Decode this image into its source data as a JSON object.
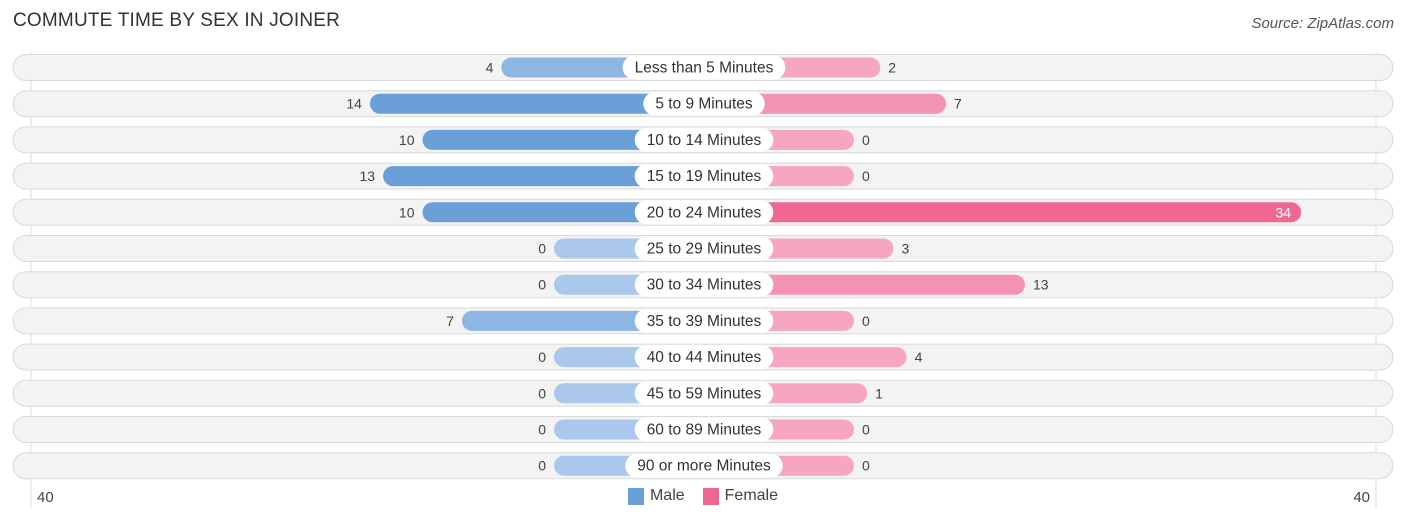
{
  "title": "COMMUTE TIME BY SEX IN JOINER",
  "source": "Source: ZipAtlas.com",
  "colors": {
    "male_strong": "#6a9fd8",
    "male_light": "#a9c8ec",
    "female_strong": "#f06792",
    "female_light": "#f7a6c0",
    "row_bg": "#f3f3f3"
  },
  "chart_data": {
    "type": "bar",
    "orientation": "horizontal-diverging",
    "title": "COMMUTE TIME BY SEX IN JOINER",
    "categories": [
      "Less than 5 Minutes",
      "5 to 9 Minutes",
      "10 to 14 Minutes",
      "15 to 19 Minutes",
      "20 to 24 Minutes",
      "25 to 29 Minutes",
      "30 to 34 Minutes",
      "35 to 39 Minutes",
      "40 to 44 Minutes",
      "45 to 59 Minutes",
      "60 to 89 Minutes",
      "90 or more Minutes"
    ],
    "series": [
      {
        "name": "Male",
        "side": "left",
        "values": [
          4,
          14,
          10,
          13,
          10,
          0,
          0,
          7,
          0,
          0,
          0,
          0
        ]
      },
      {
        "name": "Female",
        "side": "right",
        "values": [
          2,
          7,
          0,
          0,
          34,
          3,
          13,
          0,
          4,
          1,
          0,
          0
        ]
      }
    ],
    "axis": {
      "left_max_label": "40",
      "right_max_label": "40",
      "range": [
        -40,
        40
      ]
    },
    "legend": {
      "position": "bottom-center",
      "entries": [
        "Male",
        "Female"
      ]
    }
  }
}
